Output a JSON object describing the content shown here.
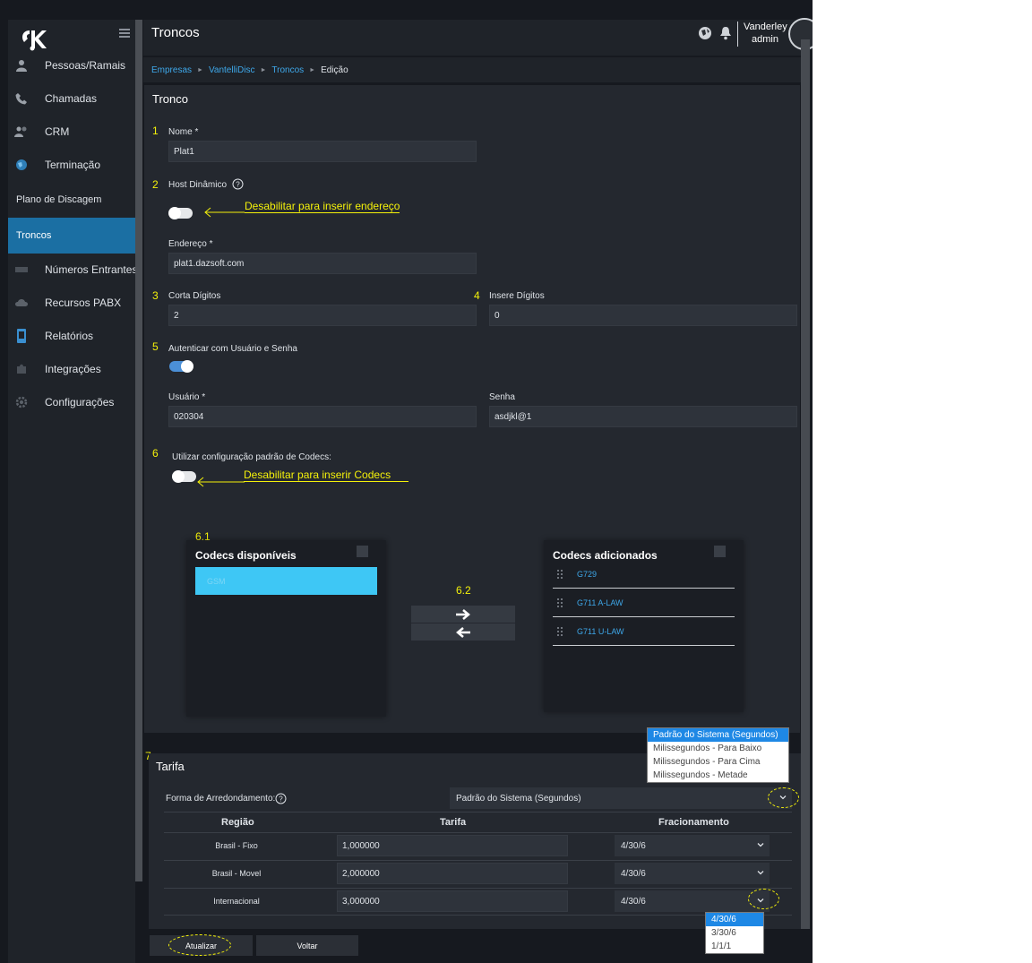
{
  "sidebar": {
    "items": [
      {
        "label": "Pessoas/Ramais",
        "icon": "person-icon"
      },
      {
        "label": "Chamadas",
        "icon": "phone-icon"
      },
      {
        "label": "CRM",
        "icon": "users-icon"
      },
      {
        "label": "Terminação",
        "icon": "globe-icon"
      },
      {
        "label": "Plano de Discagem"
      },
      {
        "label": "Troncos"
      },
      {
        "label": "Números Entrantes",
        "icon": "inbound-icon"
      },
      {
        "label": "Recursos PABX",
        "icon": "cloud-icon"
      },
      {
        "label": "Relatórios",
        "icon": "report-icon"
      },
      {
        "label": "Integrações",
        "icon": "puzzle-icon"
      },
      {
        "label": "Configurações",
        "icon": "gear-icon"
      }
    ]
  },
  "header": {
    "title": "Troncos",
    "user_name": "Vanderley",
    "user_role": "admin"
  },
  "breadcrumb": [
    "Empresas",
    "VantelliDisc",
    "Troncos",
    "Edição"
  ],
  "form": {
    "title": "Tronco",
    "nome_label": "Nome *",
    "nome_value": "Plat1",
    "host_label": "Host Dinâmico",
    "host_annot": "Desabilitar para inserir endereço",
    "endereco_label": "Endereço *",
    "endereco_value": "plat1.dazsoft.com",
    "corta_label": "Corta Dígitos",
    "corta_value": "2",
    "insere_label": "Insere Dígitos",
    "insere_value": "0",
    "auth_label": "Autenticar com Usuário e Senha",
    "usuario_label": "Usuário *",
    "usuario_value": "020304",
    "senha_label": "Senha",
    "senha_value": "asdjkl@1",
    "codec_cfg_label": "Utilizar configuração padrão de Codecs:",
    "codec_annot": "Desabilitar para inserir Codecs"
  },
  "annotations": {
    "n1": "1",
    "n2": "2",
    "n3": "3",
    "n4": "4",
    "n5": "5",
    "n6": "6",
    "n61": "6.1",
    "n62": "6.2",
    "n7": "7"
  },
  "codecs": {
    "available_title": "Codecs disponíveis",
    "available": [
      "GSM"
    ],
    "added_title": "Codecs adicionados",
    "added": [
      "G729",
      "G711 A-LAW",
      "G711 U-LAW"
    ]
  },
  "tarifa": {
    "title": "Tarifa",
    "arred_label": "Forma de Arredondamento:",
    "arred_value": "Padrão do Sistema (Segundos)",
    "arred_options": [
      "Padrão do Sistema (Segundos)",
      "Milissegundos - Para Baixo",
      "Milissegundos - Para Cima",
      "Milissegundos - Metade"
    ],
    "columns": [
      "Região",
      "Tarifa",
      "Fracionamento"
    ],
    "rows": [
      {
        "regiao": "Brasil - Fixo",
        "tarifa": "1,000000",
        "frac": "4/30/6"
      },
      {
        "regiao": "Brasil - Movel",
        "tarifa": "2,000000",
        "frac": "4/30/6"
      },
      {
        "regiao": "Internacional",
        "tarifa": "3,000000",
        "frac": "4/30/6"
      }
    ],
    "frac_options": [
      "4/30/6",
      "3/30/6",
      "1/1/1"
    ]
  },
  "buttons": {
    "update": "Atualizar",
    "back": "Voltar"
  },
  "colors": {
    "accent": "#1b6fa3",
    "link": "#3ea8ea",
    "annotation": "#f4f10a",
    "background": "#16191f"
  }
}
